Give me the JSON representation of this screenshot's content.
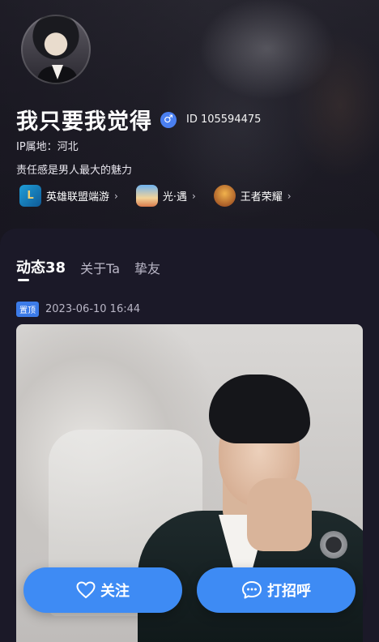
{
  "profile": {
    "name": "我只要我觉得",
    "gender_icon": "male-icon",
    "id_text": "ID 105594475",
    "ip_location": "IP属地：河北",
    "bio": "责任感是男人最大的魅力"
  },
  "games": [
    {
      "label": "英雄联盟端游",
      "icon": "league-of-legends-icon",
      "icon_text": "L"
    },
    {
      "label": "光·遇",
      "icon": "sky-game-icon",
      "icon_text": ""
    },
    {
      "label": "王者荣耀",
      "icon": "honor-of-kings-icon",
      "icon_text": ""
    }
  ],
  "tabs": [
    {
      "label": "动态38",
      "active": true
    },
    {
      "label": "关于Ta",
      "active": false
    },
    {
      "label": "挚友",
      "active": false
    }
  ],
  "post": {
    "pin_label": "置顶",
    "time": "2023-06-10 16:44"
  },
  "actions": {
    "follow_label": "关注",
    "greet_label": "打招呼"
  },
  "colors": {
    "accent": "#3e8bf4",
    "background": "#1b1928",
    "gender_badge": "#4a7ff0"
  }
}
